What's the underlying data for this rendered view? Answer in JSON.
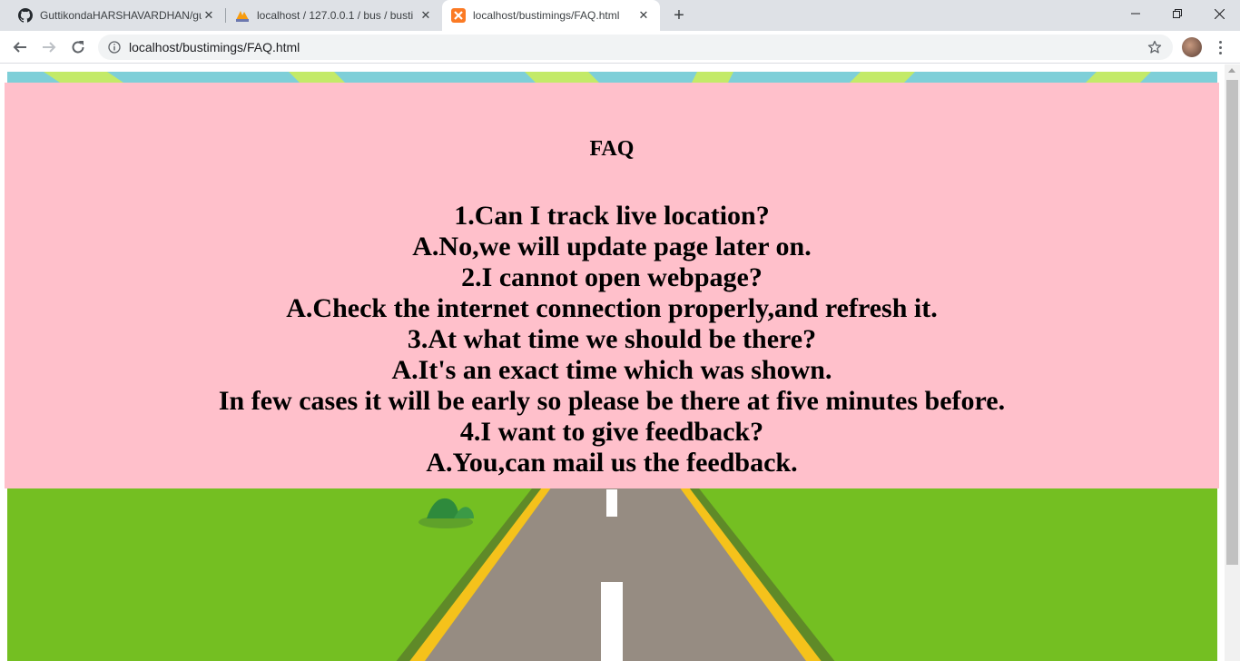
{
  "browser": {
    "tabs": [
      {
        "title": "GuttikondaHARSHAVARDHAN/gu",
        "icon": "github-icon",
        "active": false
      },
      {
        "title": "localhost / 127.0.0.1 / bus / busti",
        "icon": "phpmyadmin-icon",
        "active": false
      },
      {
        "title": "localhost/bustimings/FAQ.html",
        "icon": "xampp-icon",
        "active": true
      }
    ],
    "new_tab_label": "+",
    "address": "localhost/bustimings/FAQ.html",
    "colors": {
      "tab_strip": "#dee1e6",
      "omnibox": "#f1f3f4"
    }
  },
  "page": {
    "title": "FAQ",
    "lines": [
      "1.Can I track live location?",
      "A.No,we will update page later on.",
      "2.I cannot open webpage?",
      "A.Check the internet connection properly,and refresh it.",
      "3.At what time we should be there?",
      "A.It's an exact time which was shown.",
      "In few cases it will be early so please be there at five minutes before.",
      "4.I want to give feedback?",
      "A.You,can mail us the feedback."
    ],
    "colors": {
      "panel": "#ffc0cb",
      "grass": "#74bf22",
      "sky": "#7ecfd8",
      "road": "#968c82",
      "road_edge": "#f5c21b"
    }
  }
}
